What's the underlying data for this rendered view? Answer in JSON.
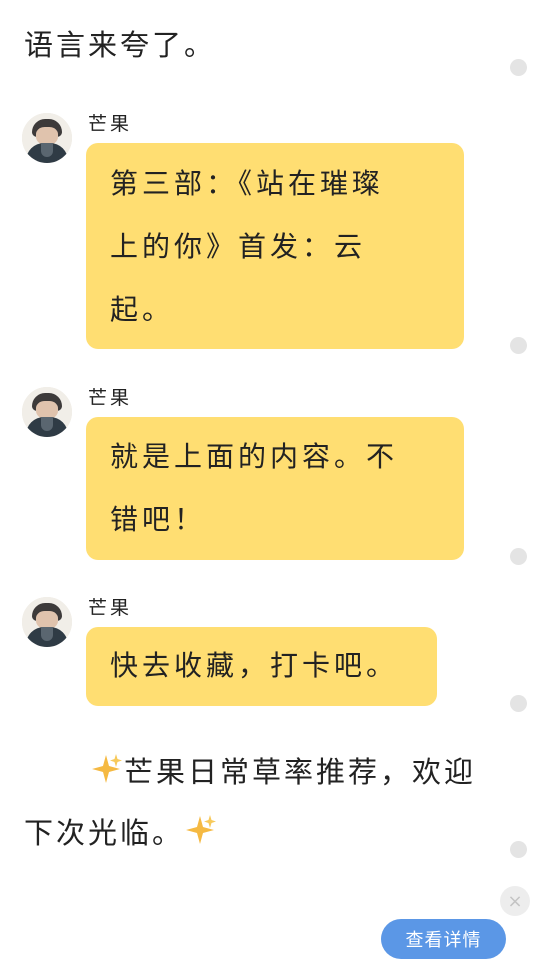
{
  "intro": {
    "text": "语言来夸了。"
  },
  "messages": [
    {
      "sender": "芒果",
      "lines": [
        "第三部：《站在璀璨",
        "上的你》首发：云",
        "起。"
      ]
    },
    {
      "sender": "芒果",
      "lines": [
        "就是上面的内容。不",
        "错吧！"
      ]
    },
    {
      "sender": "芒果",
      "lines": [
        "快去收藏，打卡吧。"
      ]
    }
  ],
  "outro": {
    "text_before": "芒果日常草率推荐，欢迎下次光临。"
  },
  "icons": {
    "sparkle": "sparkle-icon",
    "close": "close-icon",
    "avatar": "avatar-photo"
  },
  "colors": {
    "bubble": "#ffde72",
    "button": "#5b97e6",
    "sparkle": "#f5b942"
  },
  "actions": {
    "detail_button": "查看详情",
    "close_glyph": "×"
  }
}
